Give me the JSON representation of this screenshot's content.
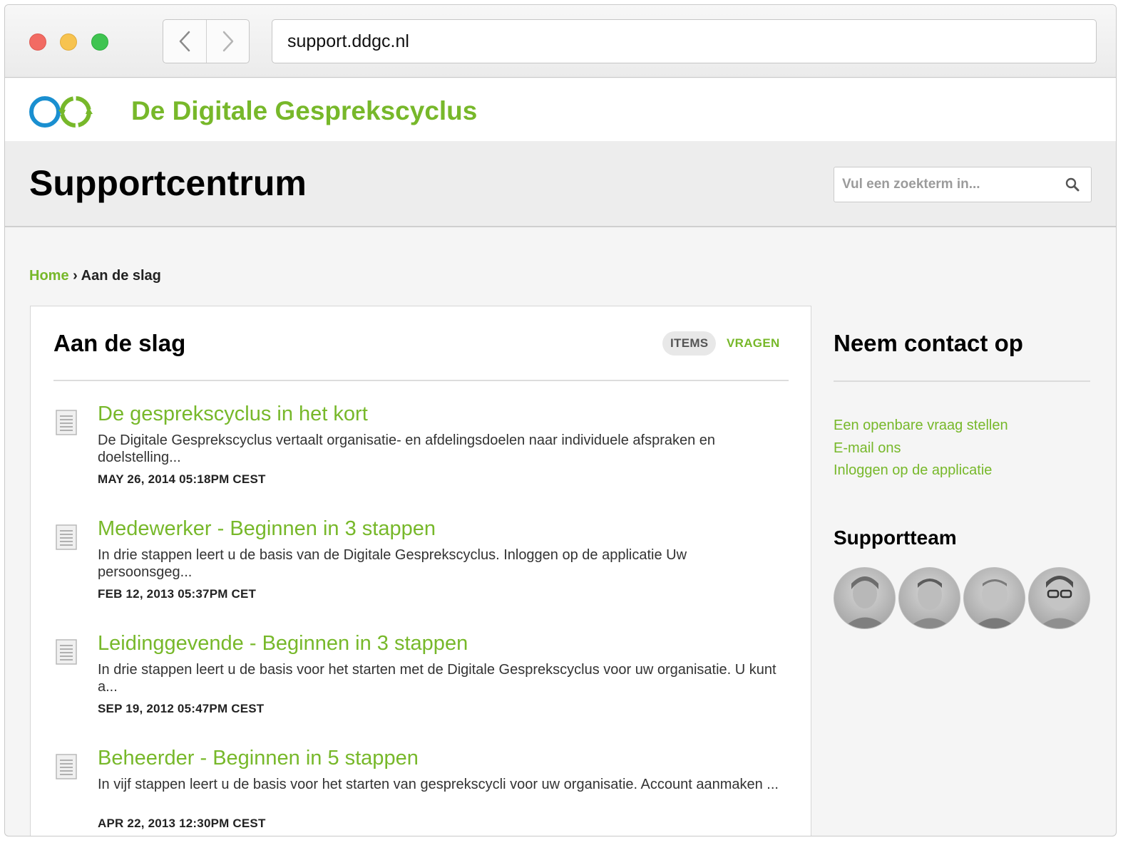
{
  "browser": {
    "url": "support.ddgc.nl"
  },
  "site": {
    "brand": "De Digitale Gesprekscyclus"
  },
  "hero": {
    "title": "Supportcentrum",
    "search_placeholder": "Vul een zoekterm in..."
  },
  "breadcrumb": {
    "home": "Home",
    "separator": "›",
    "current": "Aan de slag"
  },
  "section": {
    "title": "Aan de slag",
    "tabs": [
      {
        "label": "ITEMS",
        "active": true
      },
      {
        "label": "VRAGEN",
        "active": false
      }
    ]
  },
  "articles": [
    {
      "title": "De gesprekscyclus in het kort",
      "excerpt": "De Digitale Gesprekscyclus vertaalt organisatie- en afdelingsdoelen naar individuele afspraken en doelstelling...",
      "date": "MAY 26, 2014 05:18PM CEST"
    },
    {
      "title": "Medewerker - Beginnen in 3 stappen",
      "excerpt": "In drie stappen leert u de basis van de Digitale Gesprekscyclus. Inloggen op de applicatie Uw persoonsgeg...",
      "date": "FEB 12, 2013 05:37PM CET"
    },
    {
      "title": "Leidinggevende - Beginnen in 3 stappen",
      "excerpt": "In drie stappen leert u de basis voor het starten met de Digitale Gesprekscyclus voor uw organisatie. U kunt a...",
      "date": "SEP 19, 2012 05:47PM CEST"
    },
    {
      "title": "Beheerder - Beginnen in 5 stappen",
      "excerpt": "In vijf stappen leert u de basis voor het starten van gesprekscycli voor uw organisatie. Account aanmaken ...",
      "date": "APR 22, 2013 12:30PM CEST"
    }
  ],
  "sidebar": {
    "contact_title": "Neem contact op",
    "links": [
      "Een openbare vraag stellen",
      "E-mail ons",
      "Inloggen op de applicatie"
    ],
    "team_title": "Supportteam",
    "team_member_count": 4
  },
  "colors": {
    "brand_green": "#77b82a",
    "logo_blue": "#1a8fd0"
  },
  "icons": [
    "chevron-left-icon",
    "chevron-right-icon",
    "search-icon",
    "document-icon",
    "logo-rings-icon"
  ]
}
